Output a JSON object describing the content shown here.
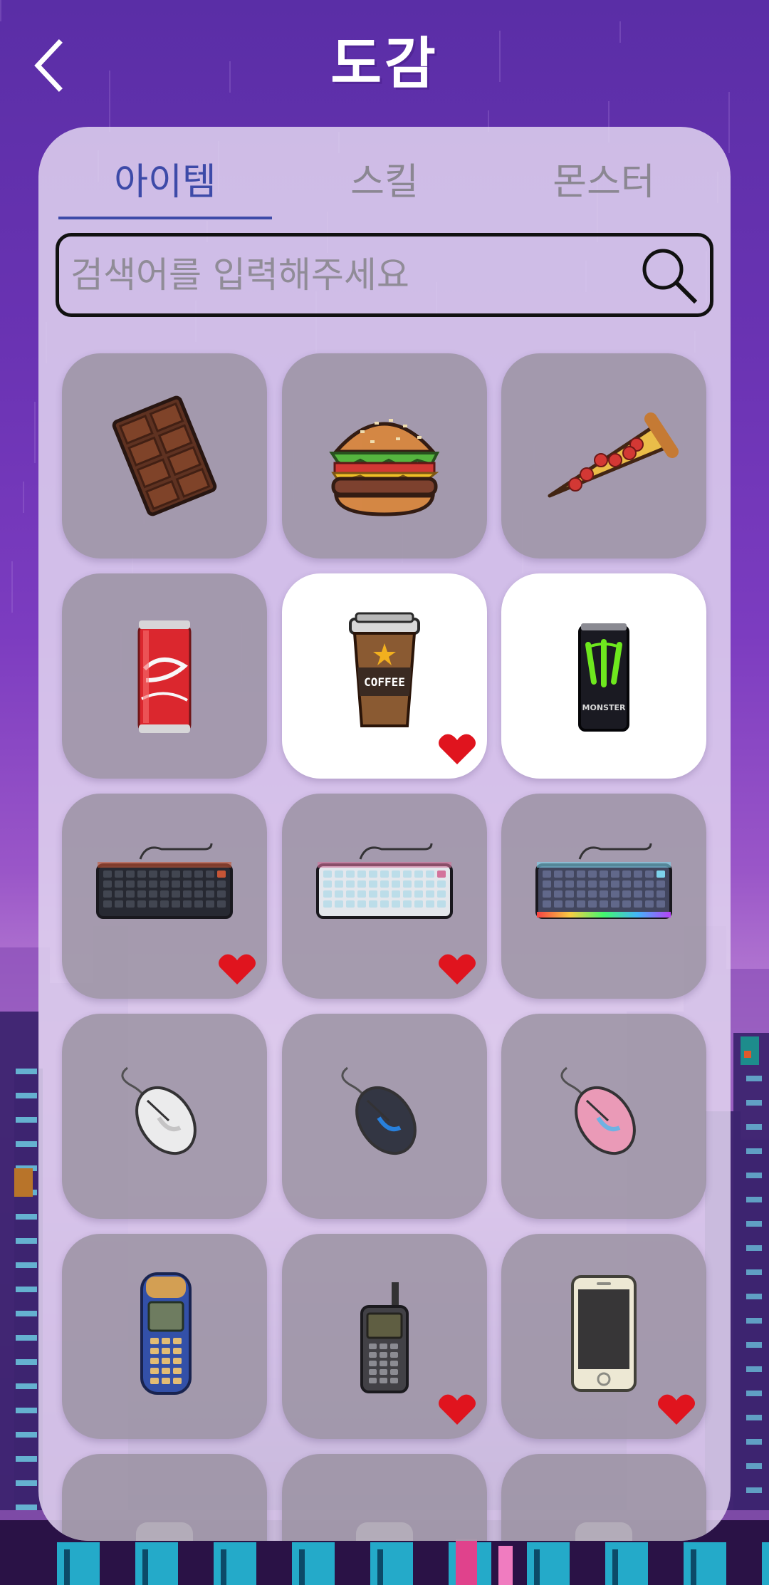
{
  "header": {
    "title": "도감",
    "back_icon": "chevron-left-icon"
  },
  "tabs": [
    {
      "label": "아이템",
      "active": true
    },
    {
      "label": "스킬",
      "active": false
    },
    {
      "label": "몬스터",
      "active": false
    }
  ],
  "search": {
    "placeholder": "검색어를 입력해주세요",
    "value": "",
    "icon": "search-icon"
  },
  "items": [
    {
      "icon": "chocolate-bar-icon",
      "owned": false,
      "favorite": false
    },
    {
      "icon": "burger-icon",
      "owned": false,
      "favorite": false
    },
    {
      "icon": "pizza-slice-icon",
      "owned": false,
      "favorite": false
    },
    {
      "icon": "cola-can-icon",
      "owned": false,
      "favorite": false
    },
    {
      "icon": "coffee-cup-icon",
      "owned": true,
      "favorite": true,
      "label": "COFFEE"
    },
    {
      "icon": "energy-drink-can-icon",
      "owned": true,
      "favorite": false,
      "label": "MONSTER"
    },
    {
      "icon": "black-keyboard-icon",
      "owned": false,
      "favorite": true
    },
    {
      "icon": "white-keyboard-icon",
      "owned": false,
      "favorite": true
    },
    {
      "icon": "rgb-keyboard-icon",
      "owned": false,
      "favorite": false
    },
    {
      "icon": "white-mouse-icon",
      "owned": false,
      "favorite": false
    },
    {
      "icon": "gaming-mouse-icon",
      "owned": false,
      "favorite": false
    },
    {
      "icon": "pink-mouse-icon",
      "owned": false,
      "favorite": false
    },
    {
      "icon": "old-cellphone-icon",
      "owned": false,
      "favorite": false
    },
    {
      "icon": "antenna-phone-icon",
      "owned": false,
      "favorite": true
    },
    {
      "icon": "smartphone-icon",
      "owned": false,
      "favorite": true
    },
    {
      "icon": "item-icon",
      "owned": false,
      "favorite": false
    },
    {
      "icon": "item-icon",
      "owned": false,
      "favorite": false
    },
    {
      "icon": "item-icon",
      "owned": false,
      "favorite": false
    }
  ],
  "colors": {
    "active_tab": "#3d4aa8",
    "inactive_tab": "#8b8792",
    "heart": "#e0141e",
    "locked_card": "#968e9c",
    "owned_card": "#ffffff"
  }
}
